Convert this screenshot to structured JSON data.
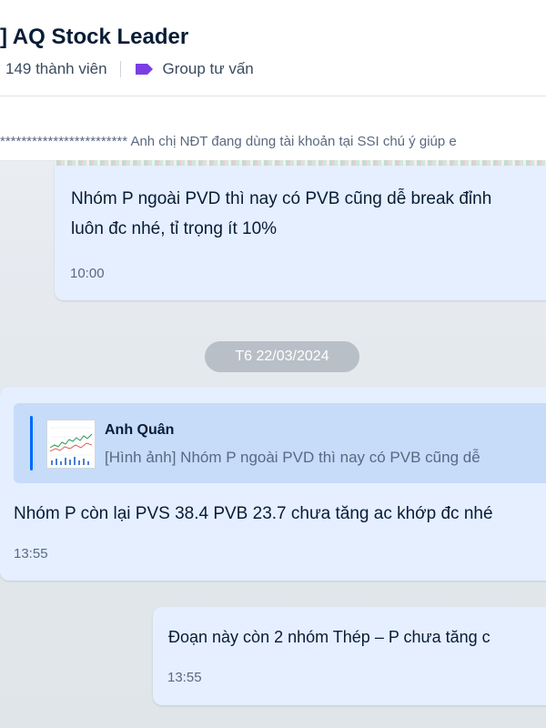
{
  "header": {
    "title": "] AQ Stock Leader",
    "members": "149 thành viên",
    "group_label": "Group tư vấn",
    "tag_color": "#7b3fe4"
  },
  "pinned": {
    "text": "************************ Anh chị NĐT đang dùng tài khoản tại SSI chú ý giúp e"
  },
  "messages": [
    {
      "lines": [
        "Nhóm P ngoài PVD thì nay có PVB cũng dễ break đỉnh",
        "luôn đc nhé, tỉ trọng ít 10%"
      ],
      "time": "10:00"
    },
    {
      "quote": {
        "name": "Anh Quân",
        "text": "[Hình ảnh] Nhóm P ngoài PVD thì nay có PVB cũng dễ"
      },
      "text": "Nhóm P còn lại PVS 38.4 PVB 23.7 chưa tăng ac khớp đc nhé",
      "time": "13:55"
    },
    {
      "text": "Đoạn này còn 2 nhóm Thép – P chưa tăng c",
      "time": "13:55"
    }
  ],
  "date_divider": "T6 22/03/2024",
  "colors": {
    "bubble_bg": "#e5efff",
    "quote_bg": "#c6dcf9",
    "accent": "#0068ff"
  }
}
